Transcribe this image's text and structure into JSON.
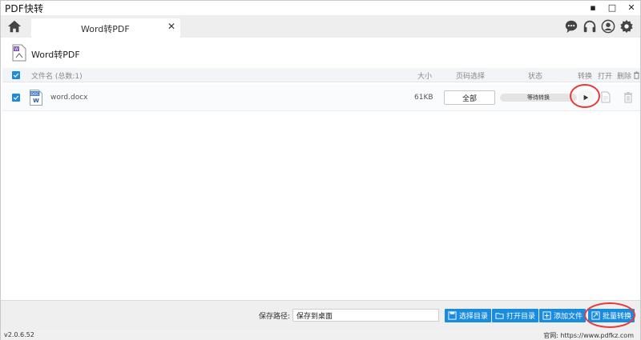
{
  "window": {
    "title": "PDF快转",
    "controls": {
      "minimize": "▪",
      "maximize": "□",
      "close": "✕"
    }
  },
  "tabbar": {
    "home_icon": "home-icon",
    "tab": {
      "label": "Word转PDF",
      "close": "✕"
    },
    "tools": [
      "chat-icon",
      "headset-icon",
      "user-icon",
      "gear-icon"
    ]
  },
  "header": {
    "title": "Word转PDF",
    "icon": "word-to-pdf-icon"
  },
  "table": {
    "columns": {
      "filename": "文件名 (总数:1)",
      "size": "大小",
      "pages": "页码选择",
      "status": "状态",
      "convert": "转换",
      "open": "打开",
      "delete": "删除"
    },
    "rows": [
      {
        "name": "word.docx",
        "icon_text": "DOC",
        "icon_letter": "W",
        "size": "61KB",
        "pages": "全部",
        "status": "等待转换"
      }
    ]
  },
  "footer": {
    "save_label": "保存路径:",
    "save_value": "保存到桌面",
    "buttons": {
      "choose_dir": "选择目录",
      "open_dir": "打开目录",
      "add_file": "添加文件",
      "batch_convert": "批量转换"
    }
  },
  "statusbar": {
    "version": "v2.0.6.52",
    "site": "官网: https://www.pdfkz.com"
  },
  "colors": {
    "accent": "#1a8ce0",
    "highlight_circle": "#e83a3a"
  }
}
